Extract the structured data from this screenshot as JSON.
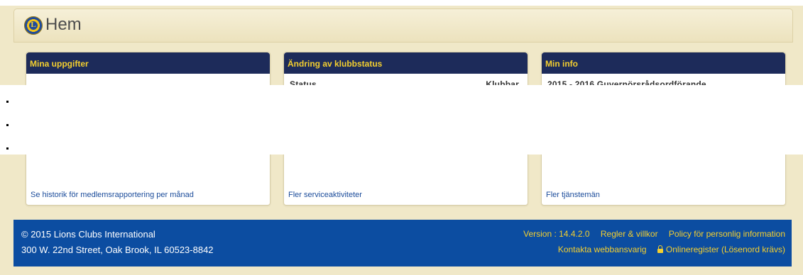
{
  "header": {
    "title": "Hem",
    "logo_text": "L"
  },
  "panels": [
    {
      "title": "Mina uppgifter",
      "peek": "",
      "link": "Se historik för medlemsrapportering per månad"
    },
    {
      "title": "Ändring av klubbstatus",
      "peek_left": "Status",
      "peek_right": "Klubbar",
      "link": "Fler serviceaktiviteter"
    },
    {
      "title": "Min info",
      "peek": "2015 - 2016 Guvernörsrådsordförande",
      "link": "Fler tjänstemän"
    }
  ],
  "footer": {
    "copyright": "© 2015 Lions Clubs International",
    "address": "300 W. 22nd Street, Oak Brook, IL 60523-8842",
    "version": "Version : 14.4.2.0",
    "terms": "Regler & villkor",
    "privacy": "Policy för personlig information",
    "contact": "Kontakta webbansvarig",
    "online_registry": "Onlineregister (Lösenord krävs)"
  },
  "icons": {
    "logo": "lions-logo-icon",
    "lock": "lock-icon"
  },
  "colors": {
    "panel_header": "#1d2b5a",
    "panel_title": "#f4cf2f",
    "footer_bg": "#0c4da1",
    "link": "#1a4b9a"
  }
}
